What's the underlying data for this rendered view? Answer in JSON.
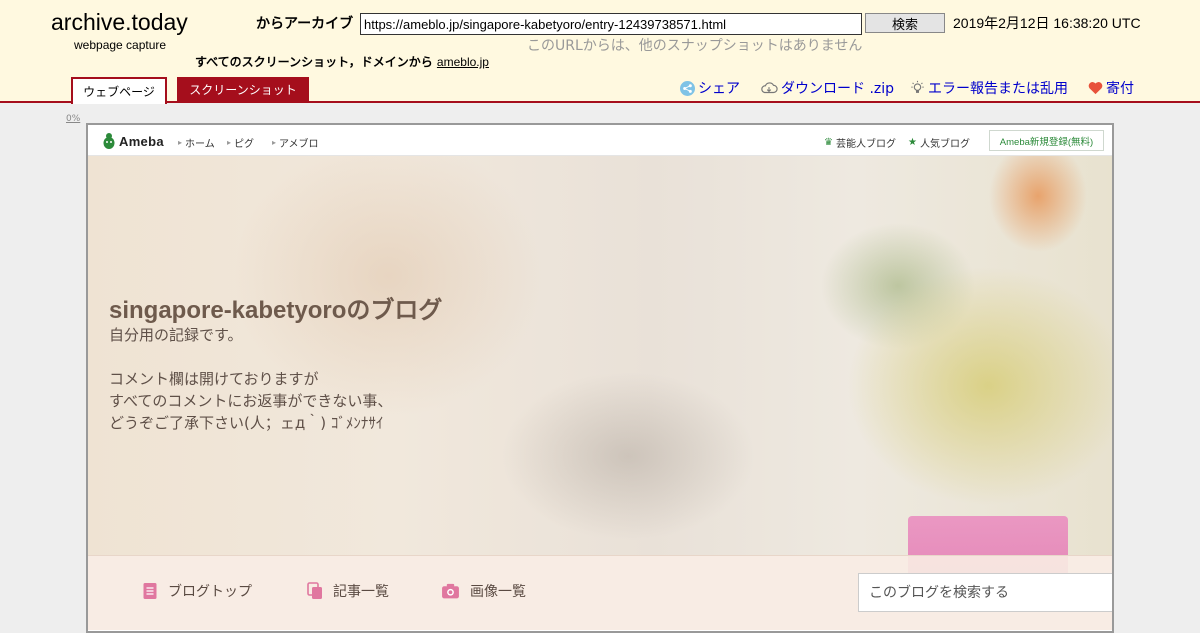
{
  "archive": {
    "logo": "archive.today",
    "logo_sub": "webpage capture",
    "archive_from_label": "からアーカイブ",
    "url_value": "https://ameblo.jp/singapore-kabetyoro/entry-12439738571.html",
    "search_button": "検索",
    "timestamp": "2019年2月12日 16:38:20 UTC",
    "no_snapshots": "このURLからは、他のスナップショットはありません",
    "domain_text": "すべてのスクリーンショット，ドメインから",
    "domain_link": "ameblo.jp",
    "tabs": {
      "webpage": "ウェブページ",
      "screenshot": "スクリーンショット"
    },
    "links": {
      "share": "シェア",
      "download": "ダウンロード .zip",
      "report": "エラー報告または乱用",
      "donate": "寄付"
    },
    "zoom": "0%"
  },
  "ameba": {
    "logo": "Ameba",
    "nav": {
      "home": "ホーム",
      "pigg": "ピグ",
      "ameblo": "アメブロ"
    },
    "celebrity_blog": "芸能人ブログ",
    "popular_blog": "人気ブログ",
    "register": "Ameba新規登録(無料)"
  },
  "blog": {
    "title": "singapore-kabetyoroのブログ",
    "desc_1": "自分用の記録です。",
    "desc_2": "コメント欄は開けておりますが",
    "desc_3": "すべてのコメントにお返事ができない事、",
    "desc_4": "どうぞご了承下さい(人；ェд｀) ｺﾞﾒﾝﾅｻｲ",
    "nav": {
      "top": "ブログトップ",
      "articles": "記事一覧",
      "images": "画像一覧"
    },
    "search_placeholder": "このブログを検索する"
  },
  "colors": {
    "header_bg": "#fff9e0",
    "accent_red": "#a50e1c",
    "link_blue": "#0000cc",
    "ameba_green": "#2c8a3a",
    "nav_icon_pink": "#e0779f"
  }
}
